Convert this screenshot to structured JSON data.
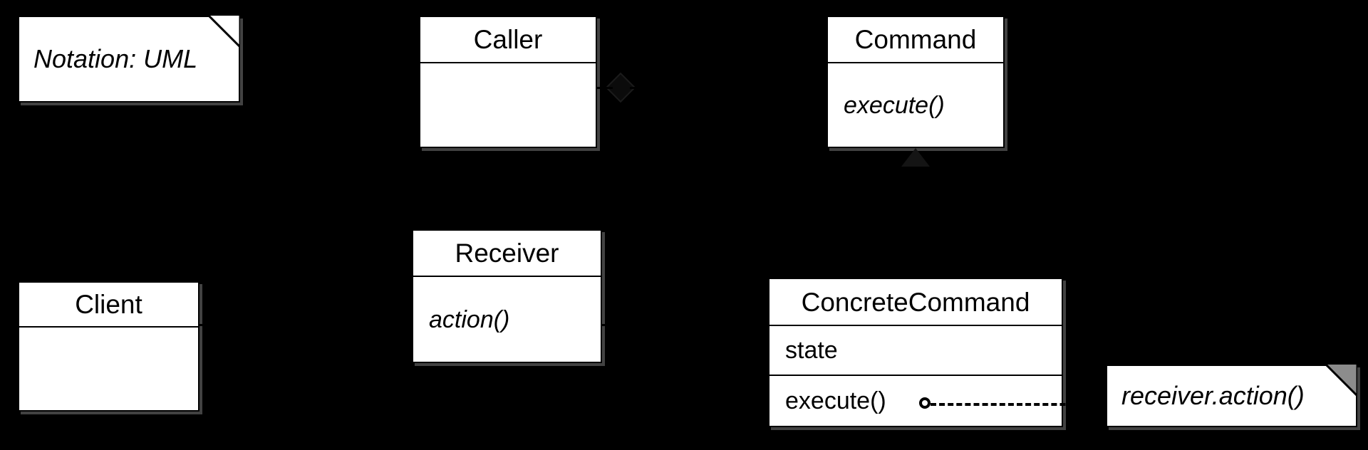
{
  "diagram": {
    "title": "Command Pattern UML Class Diagram",
    "background_color": "#000000",
    "box_fill_color": "#ffffff",
    "line_color": "#000000",
    "shadow_color": "#787878",
    "fold_fill_color": "#8c8c8c"
  },
  "notes": [
    {
      "id": "notation-note",
      "text": "Notation: UML",
      "fold_filled": false
    },
    {
      "id": "receiver-action-note",
      "text": "receiver.action()",
      "fold_filled": true
    }
  ],
  "classes": [
    {
      "id": "caller",
      "name": "Caller",
      "attributes": [],
      "operations": []
    },
    {
      "id": "command",
      "name": "Command",
      "abstract": true,
      "attributes": [],
      "operations": [
        "execute()"
      ]
    },
    {
      "id": "receiver",
      "name": "Receiver",
      "attributes": [],
      "operations": [
        "action()"
      ]
    },
    {
      "id": "client",
      "name": "Client",
      "attributes": [],
      "operations": []
    },
    {
      "id": "concrete-command",
      "name": "ConcreteCommand",
      "attributes": [
        "state"
      ],
      "operations": [
        "execute()"
      ]
    }
  ],
  "connectors": [
    {
      "id": "caller-command-aggregation",
      "type": "aggregation",
      "from": "caller",
      "to": "command"
    },
    {
      "id": "command-concretecommand-generalization",
      "type": "generalization",
      "from": "concrete-command",
      "to": "command"
    },
    {
      "id": "client-receiver-association",
      "type": "association",
      "from": "client",
      "to": "receiver"
    },
    {
      "id": "concretecommand-receiver-association",
      "type": "association",
      "from": "concrete-command",
      "to": "receiver"
    },
    {
      "id": "execute-note-link",
      "type": "note-anchor",
      "from": "concrete-command",
      "to": "receiver-action-note"
    }
  ]
}
